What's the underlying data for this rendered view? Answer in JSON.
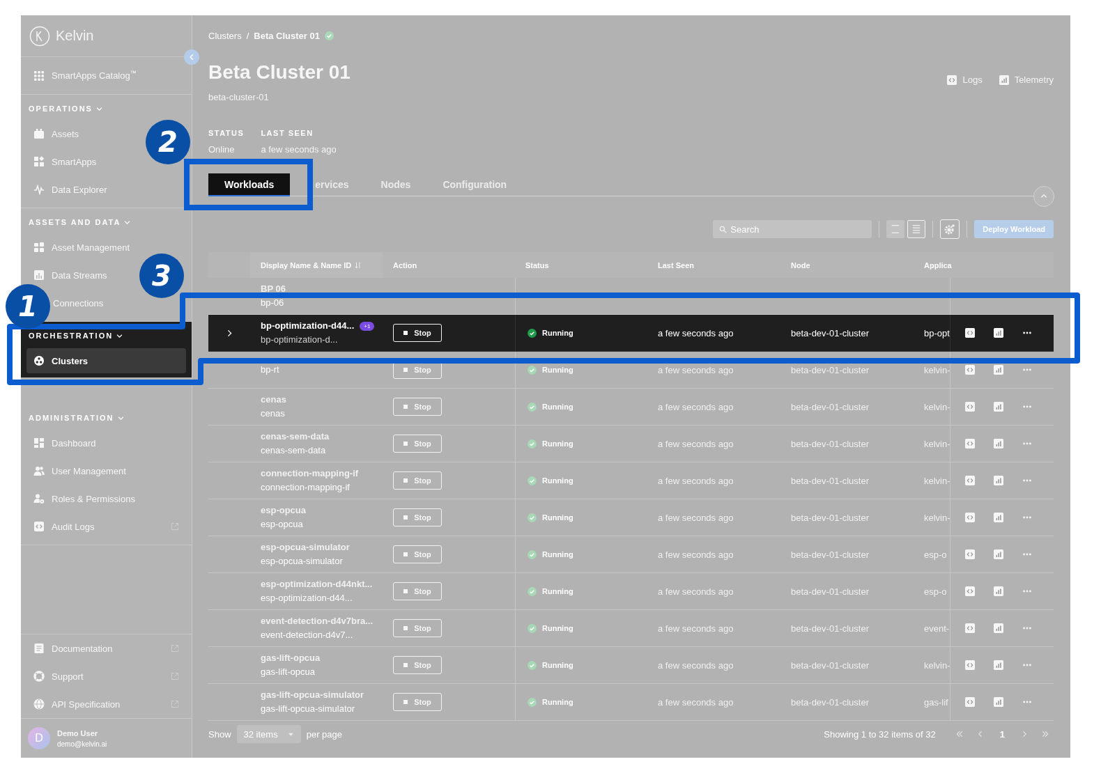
{
  "annotations": [
    {
      "label": "1"
    },
    {
      "label": "2"
    },
    {
      "label": "3"
    }
  ],
  "sidebar": {
    "logo": "Kelvin",
    "catalog": "SmartApps Catalog$^{™}$",
    "sections": [
      {
        "title": "OPERATIONS",
        "highlighted": false,
        "items": [
          {
            "label": "Assets",
            "selected": false,
            "external": false
          },
          {
            "label": "SmartApps",
            "selected": false,
            "external": false
          },
          {
            "label": "Data Explorer",
            "selected": false,
            "external": false
          }
        ]
      },
      {
        "title": "ASSETS AND DATA",
        "highlighted": false,
        "items": [
          {
            "label": "Asset Management",
            "selected": false,
            "external": false
          },
          {
            "label": "Data Streams",
            "selected": false,
            "external": false
          },
          {
            "label": "Connections",
            "selected": false,
            "external": false
          }
        ]
      },
      {
        "title": "ORCHESTRATION",
        "highlighted": true,
        "items": [
          {
            "label": "Clusters",
            "selected": true,
            "external": false
          }
        ]
      },
      {
        "title": "ADMINISTRATION",
        "highlighted": false,
        "items": [
          {
            "label": "Dashboard",
            "selected": false,
            "external": false
          },
          {
            "label": "User Management",
            "selected": false,
            "external": false
          },
          {
            "label": "Roles & Permissions",
            "selected": false,
            "external": false
          },
          {
            "label": "Audit Logs",
            "selected": false,
            "external": true
          }
        ]
      }
    ],
    "footer_links": [
      {
        "label": "Documentation",
        "external": true
      },
      {
        "label": "Support",
        "external": true
      },
      {
        "label": "API Specification",
        "external": true
      }
    ],
    "user": {
      "initial": "D",
      "name": "Demo User",
      "email": "demo@kelvin.ai"
    }
  },
  "breadcrumb": {
    "items": [
      "Clusters",
      "Beta Cluster 01"
    ],
    "separator": "/"
  },
  "title": "Beta Cluster 01",
  "subtitle": "beta-cluster-01",
  "header_actions": [
    "Logs",
    "Telemetry"
  ],
  "info": [
    {
      "label": "STATUS",
      "value": "Online"
    },
    {
      "label": "LAST SEEN",
      "value": "a few seconds ago"
    }
  ],
  "tabs": [
    {
      "label": "Workloads",
      "selected": true,
      "highlighted": true
    },
    {
      "label": "ervices",
      "selected": false,
      "highlighted": false
    },
    {
      "label": "Nodes",
      "selected": false,
      "highlighted": false
    },
    {
      "label": "Configuration",
      "selected": false,
      "highlighted": false
    }
  ],
  "toolbar": {
    "search": {
      "placeholder": "Search"
    },
    "views": [
      {
        "selected": false
      },
      {
        "selected": true
      }
    ],
    "deploy": "Deploy Workload"
  },
  "table": {
    "columns": [
      "Display Name & Name ID",
      "Action",
      "Status",
      "Last Seen",
      "Node",
      "Applica"
    ],
    "rows": [
      {
        "name": "BP 06",
        "id": "bp-06",
        "highlighted": false,
        "expandable": false
      },
      {
        "name": "bp-optimization-d44...",
        "id": "bp-optimization-d...",
        "badge": "+1",
        "action": "Stop",
        "status": "Running",
        "last_seen": "a few seconds ago",
        "node": "beta-dev-01-cluster",
        "application": "bp-opt",
        "highlighted": true,
        "expandable": true
      },
      {
        "id": "bp-rt",
        "action": "Stop",
        "status": "Running",
        "last_seen": "a few seconds ago",
        "node": "beta-dev-01-cluster",
        "application": "kelvin-",
        "highlighted": false,
        "expandable": false
      },
      {
        "name": "cenas",
        "id": "cenas",
        "action": "Stop",
        "status": "Running",
        "last_seen": "a few seconds ago",
        "node": "beta-dev-01-cluster",
        "application": "kelvin-",
        "highlighted": false,
        "expandable": false
      },
      {
        "name": "cenas-sem-data",
        "id": "cenas-sem-data",
        "action": "Stop",
        "status": "Running",
        "last_seen": "a few seconds ago",
        "node": "beta-dev-01-cluster",
        "application": "kelvin-",
        "highlighted": false,
        "expandable": false
      },
      {
        "name": "connection-mapping-if",
        "id": "connection-mapping-if",
        "action": "Stop",
        "status": "Running",
        "last_seen": "a few seconds ago",
        "node": "beta-dev-01-cluster",
        "application": "kelvin-",
        "highlighted": false,
        "expandable": false
      },
      {
        "name": "esp-opcua",
        "id": "esp-opcua",
        "action": "Stop",
        "status": "Running",
        "last_seen": "a few seconds ago",
        "node": "beta-dev-01-cluster",
        "application": "kelvin-",
        "highlighted": false,
        "expandable": false
      },
      {
        "name": "esp-opcua-simulator",
        "id": "esp-opcua-simulator",
        "action": "Stop",
        "status": "Running",
        "last_seen": "a few seconds ago",
        "node": "beta-dev-01-cluster",
        "application": "esp-o",
        "highlighted": false,
        "expandable": false
      },
      {
        "name": "esp-optimization-d44nkt...",
        "id": "esp-optimization-d44...",
        "action": "Stop",
        "status": "Running",
        "last_seen": "a few seconds ago",
        "node": "beta-dev-01-cluster",
        "application": "esp-o",
        "highlighted": false,
        "expandable": false
      },
      {
        "name": "event-detection-d4v7bra...",
        "id": "event-detection-d4v7...",
        "action": "Stop",
        "status": "Running",
        "last_seen": "a few seconds ago",
        "node": "beta-dev-01-cluster",
        "application": "event-",
        "highlighted": false,
        "expandable": false
      },
      {
        "name": "gas-lift-opcua",
        "id": "gas-lift-opcua",
        "action": "Stop",
        "status": "Running",
        "last_seen": "a few seconds ago",
        "node": "beta-dev-01-cluster",
        "application": "kelvin-",
        "highlighted": false,
        "expandable": false
      },
      {
        "name": "gas-lift-opcua-simulator",
        "id": "gas-lift-opcua-simulator",
        "action": "Stop",
        "status": "Running",
        "last_seen": "a few seconds ago",
        "node": "beta-dev-01-cluster",
        "application": "gas-lif",
        "highlighted": false,
        "expandable": false
      }
    ]
  },
  "pagination": {
    "show": "Show",
    "page_size": "32 items",
    "per_page": "per page",
    "summary": "Showing 1 to 32 items of 32",
    "current": "1"
  }
}
